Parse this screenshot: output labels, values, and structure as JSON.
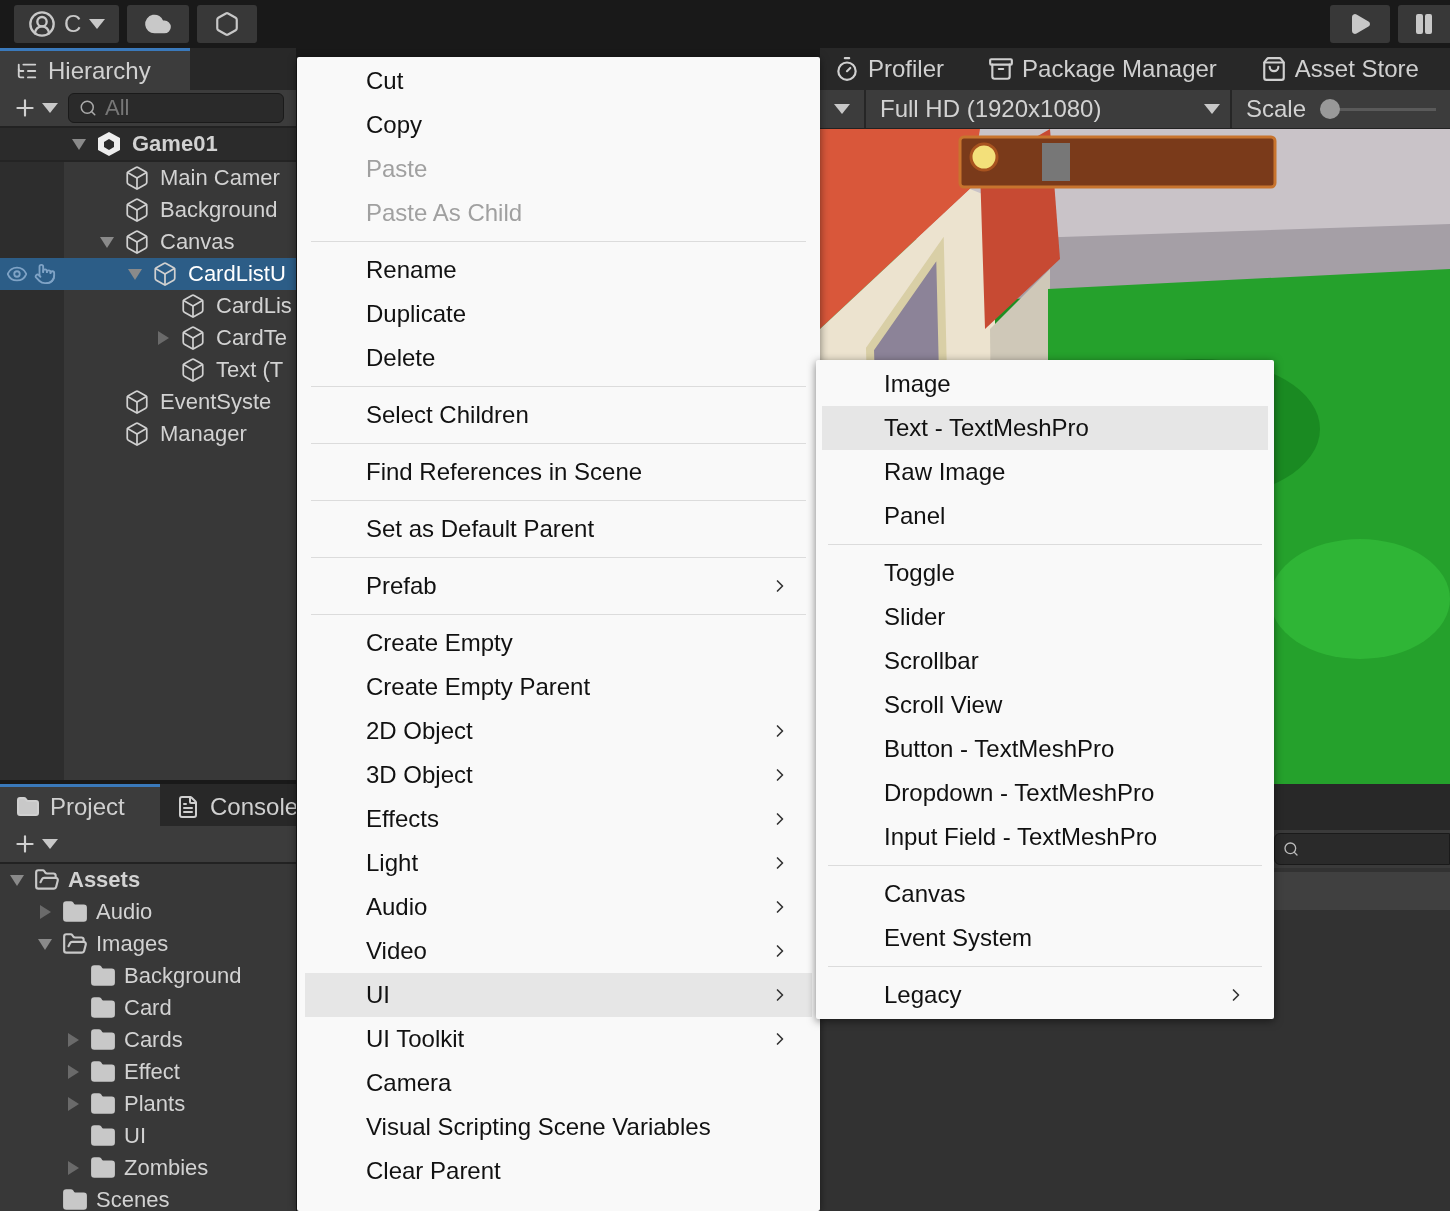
{
  "toolbar": {
    "account": {
      "label": "C"
    }
  },
  "hierarchy": {
    "tab": {
      "label": "Hierarchy",
      "selected": true
    },
    "search": {
      "placeholder": "All"
    },
    "items": [
      {
        "label": "Game01",
        "kind": "scene",
        "expanded": true,
        "selected": false,
        "children": [
          {
            "label": "Main Camer",
            "kind": "object",
            "selected": false
          },
          {
            "label": "Background",
            "kind": "object",
            "selected": false
          },
          {
            "label": "Canvas",
            "kind": "object",
            "expanded": true,
            "selected": false,
            "children": [
              {
                "label": "CardListU",
                "kind": "object",
                "expanded": true,
                "selected": true,
                "children": [
                  {
                    "label": "CardLis",
                    "kind": "object",
                    "selected": false
                  },
                  {
                    "label": "CardTe",
                    "kind": "object",
                    "expanded": false,
                    "selected": false
                  },
                  {
                    "label": "Text (T",
                    "kind": "object",
                    "selected": false
                  }
                ]
              }
            ]
          },
          {
            "label": "EventSyste",
            "kind": "object",
            "selected": false
          },
          {
            "label": "Manager",
            "kind": "object",
            "selected": false
          }
        ]
      }
    ]
  },
  "project": {
    "tabs": [
      {
        "label": "Project",
        "kind": "project",
        "selected": true
      },
      {
        "label": "Console",
        "kind": "console",
        "selected": false
      }
    ],
    "items": [
      {
        "label": "Assets",
        "expanded": true,
        "children": [
          {
            "label": "Audio",
            "expanded": false
          },
          {
            "label": "Images",
            "expanded": true,
            "children": [
              {
                "label": "Background"
              },
              {
                "label": "Card"
              },
              {
                "label": "Cards",
                "expanded": false
              },
              {
                "label": "Effect",
                "expanded": false
              },
              {
                "label": "Plants",
                "expanded": false
              },
              {
                "label": "UI"
              },
              {
                "label": "Zombies",
                "expanded": false
              }
            ]
          },
          {
            "label": "Scenes"
          }
        ]
      }
    ]
  },
  "editor_tabs": [
    {
      "label": "Profiler",
      "kind": "profiler",
      "selected": false
    },
    {
      "label": "Package Manager",
      "kind": "package",
      "selected": false
    },
    {
      "label": "Asset Store",
      "kind": "store",
      "selected": false
    }
  ],
  "game_toolbar": {
    "display": "Full HD (1920x1080)",
    "scale": {
      "label": "Scale",
      "level": 0
    }
  },
  "context_menu": {
    "items": [
      {
        "kind": "item",
        "label": "Cut",
        "disabled": false,
        "submenu": false,
        "highlighted": false
      },
      {
        "kind": "item",
        "label": "Copy",
        "disabled": false,
        "submenu": false,
        "highlighted": false
      },
      {
        "kind": "item",
        "label": "Paste",
        "disabled": true,
        "submenu": false,
        "highlighted": false
      },
      {
        "kind": "item",
        "label": "Paste As Child",
        "disabled": true,
        "submenu": false,
        "highlighted": false
      },
      {
        "kind": "separator"
      },
      {
        "kind": "item",
        "label": "Rename",
        "disabled": false,
        "submenu": false,
        "highlighted": false
      },
      {
        "kind": "item",
        "label": "Duplicate",
        "disabled": false,
        "submenu": false,
        "highlighted": false
      },
      {
        "kind": "item",
        "label": "Delete",
        "disabled": false,
        "submenu": false,
        "highlighted": false
      },
      {
        "kind": "separator"
      },
      {
        "kind": "item",
        "label": "Select Children",
        "disabled": false,
        "submenu": false,
        "highlighted": false
      },
      {
        "kind": "separator"
      },
      {
        "kind": "item",
        "label": "Find References in Scene",
        "disabled": false,
        "submenu": false,
        "highlighted": false
      },
      {
        "kind": "separator"
      },
      {
        "kind": "item",
        "label": "Set as Default Parent",
        "disabled": false,
        "submenu": false,
        "highlighted": false
      },
      {
        "kind": "separator"
      },
      {
        "kind": "item",
        "label": "Prefab",
        "disabled": false,
        "submenu": true,
        "highlighted": false
      },
      {
        "kind": "separator"
      },
      {
        "kind": "item",
        "label": "Create Empty",
        "disabled": false,
        "submenu": false,
        "highlighted": false
      },
      {
        "kind": "item",
        "label": "Create Empty Parent",
        "disabled": false,
        "submenu": false,
        "highlighted": false
      },
      {
        "kind": "item",
        "label": "2D Object",
        "disabled": false,
        "submenu": true,
        "highlighted": false
      },
      {
        "kind": "item",
        "label": "3D Object",
        "disabled": false,
        "submenu": true,
        "highlighted": false
      },
      {
        "kind": "item",
        "label": "Effects",
        "disabled": false,
        "submenu": true,
        "highlighted": false
      },
      {
        "kind": "item",
        "label": "Light",
        "disabled": false,
        "submenu": true,
        "highlighted": false
      },
      {
        "kind": "item",
        "label": "Audio",
        "disabled": false,
        "submenu": true,
        "highlighted": false
      },
      {
        "kind": "item",
        "label": "Video",
        "disabled": false,
        "submenu": true,
        "highlighted": false
      },
      {
        "kind": "item",
        "label": "UI",
        "disabled": false,
        "submenu": true,
        "highlighted": true
      },
      {
        "kind": "item",
        "label": "UI Toolkit",
        "disabled": false,
        "submenu": true,
        "highlighted": false
      },
      {
        "kind": "item",
        "label": "Camera",
        "disabled": false,
        "submenu": false,
        "highlighted": false
      },
      {
        "kind": "item",
        "label": "Visual Scripting Scene Variables",
        "disabled": false,
        "submenu": false,
        "highlighted": false
      },
      {
        "kind": "item",
        "label": "Clear Parent",
        "disabled": false,
        "submenu": false,
        "highlighted": false
      }
    ]
  },
  "submenu": {
    "items": [
      {
        "kind": "item",
        "label": "Image",
        "disabled": false,
        "submenu": false,
        "highlighted": false
      },
      {
        "kind": "item",
        "label": "Text - TextMeshPro",
        "disabled": false,
        "submenu": false,
        "highlighted": true
      },
      {
        "kind": "item",
        "label": "Raw Image",
        "disabled": false,
        "submenu": false,
        "highlighted": false
      },
      {
        "kind": "item",
        "label": "Panel",
        "disabled": false,
        "submenu": false,
        "highlighted": false
      },
      {
        "kind": "separator"
      },
      {
        "kind": "item",
        "label": "Toggle",
        "disabled": false,
        "submenu": false,
        "highlighted": false
      },
      {
        "kind": "item",
        "label": "Slider",
        "disabled": false,
        "submenu": false,
        "highlighted": false
      },
      {
        "kind": "item",
        "label": "Scrollbar",
        "disabled": false,
        "submenu": false,
        "highlighted": false
      },
      {
        "kind": "item",
        "label": "Scroll View",
        "disabled": false,
        "submenu": false,
        "highlighted": false
      },
      {
        "kind": "item",
        "label": "Button - TextMeshPro",
        "disabled": false,
        "submenu": false,
        "highlighted": false
      },
      {
        "kind": "item",
        "label": "Dropdown - TextMeshPro",
        "disabled": false,
        "submenu": false,
        "highlighted": false
      },
      {
        "kind": "item",
        "label": "Input Field - TextMeshPro",
        "disabled": false,
        "submenu": false,
        "highlighted": false
      },
      {
        "kind": "separator"
      },
      {
        "kind": "item",
        "label": "Canvas",
        "disabled": false,
        "submenu": false,
        "highlighted": false
      },
      {
        "kind": "item",
        "label": "Event System",
        "disabled": false,
        "submenu": false,
        "highlighted": false
      },
      {
        "kind": "separator"
      },
      {
        "kind": "item",
        "label": "Legacy",
        "disabled": false,
        "submenu": true,
        "highlighted": false
      }
    ]
  }
}
